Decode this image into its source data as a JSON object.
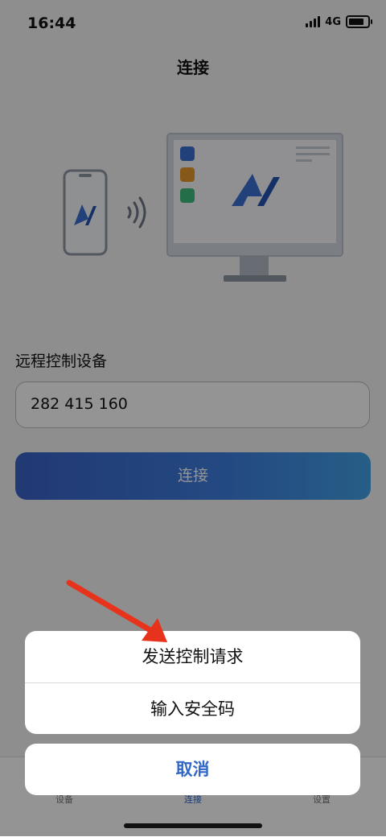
{
  "status": {
    "time": "16:44",
    "network": "4G"
  },
  "header": {
    "title": "连接"
  },
  "form": {
    "label": "远程控制设备",
    "device_id": "282 415 160",
    "connect_label": "连接"
  },
  "tabs": [
    {
      "label": "设备"
    },
    {
      "label": "连接"
    },
    {
      "label": "设置"
    }
  ],
  "action_sheet": {
    "options": [
      {
        "label": "发送控制请求"
      },
      {
        "label": "输入安全码"
      }
    ],
    "cancel_label": "取消"
  },
  "colors": {
    "accent": "#2f66c7",
    "annotation_arrow": "#e8331c",
    "app_icon_blue": "#3c6fd0",
    "app_icon_orange": "#e89a2a",
    "app_icon_green": "#3fbf7f"
  },
  "icons": [
    "phone-icon",
    "wireless-icon",
    "monitor-icon",
    "app-logo-icon"
  ]
}
